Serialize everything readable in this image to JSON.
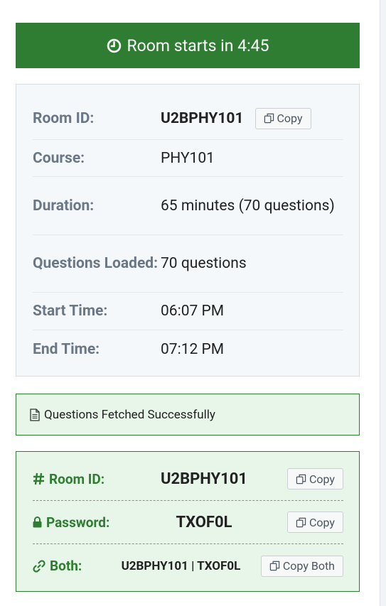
{
  "banner": {
    "text": "Room starts in 4:45"
  },
  "room_info": {
    "rows": [
      {
        "label": "Room ID:",
        "value": "U2BPHY101"
      },
      {
        "label": "Course:",
        "value": "PHY101"
      },
      {
        "label": "Duration:",
        "value": "65 minutes (70 questions)"
      },
      {
        "label": "Questions Loaded:",
        "value": "70 questions"
      },
      {
        "label": "Start Time:",
        "value": "06:07 PM"
      },
      {
        "label": "End Time:",
        "value": "07:12 PM"
      }
    ],
    "copy_label": "Copy"
  },
  "status": {
    "message": "Questions Fetched Successfully"
  },
  "credentials": {
    "room_id": {
      "label": "Room ID:",
      "value": "U2BPHY101",
      "button": "Copy"
    },
    "password": {
      "label": "Password:",
      "value": "TXOF0L",
      "button": "Copy"
    },
    "both": {
      "label": "Both:",
      "value": "U2BPHY101 | TXOF0L",
      "button": "Copy Both"
    }
  },
  "colors": {
    "accent_green": "#2e7d32",
    "success_bg": "#e8f5e9",
    "card_bg": "#f5f8fb",
    "label_gray": "#6b7785"
  },
  "icons": {
    "banner": "clock-icon",
    "copy": "copy-icon",
    "status": "file-text-icon",
    "room_id": "hash-icon",
    "password": "lock-icon",
    "both": "link-icon"
  }
}
